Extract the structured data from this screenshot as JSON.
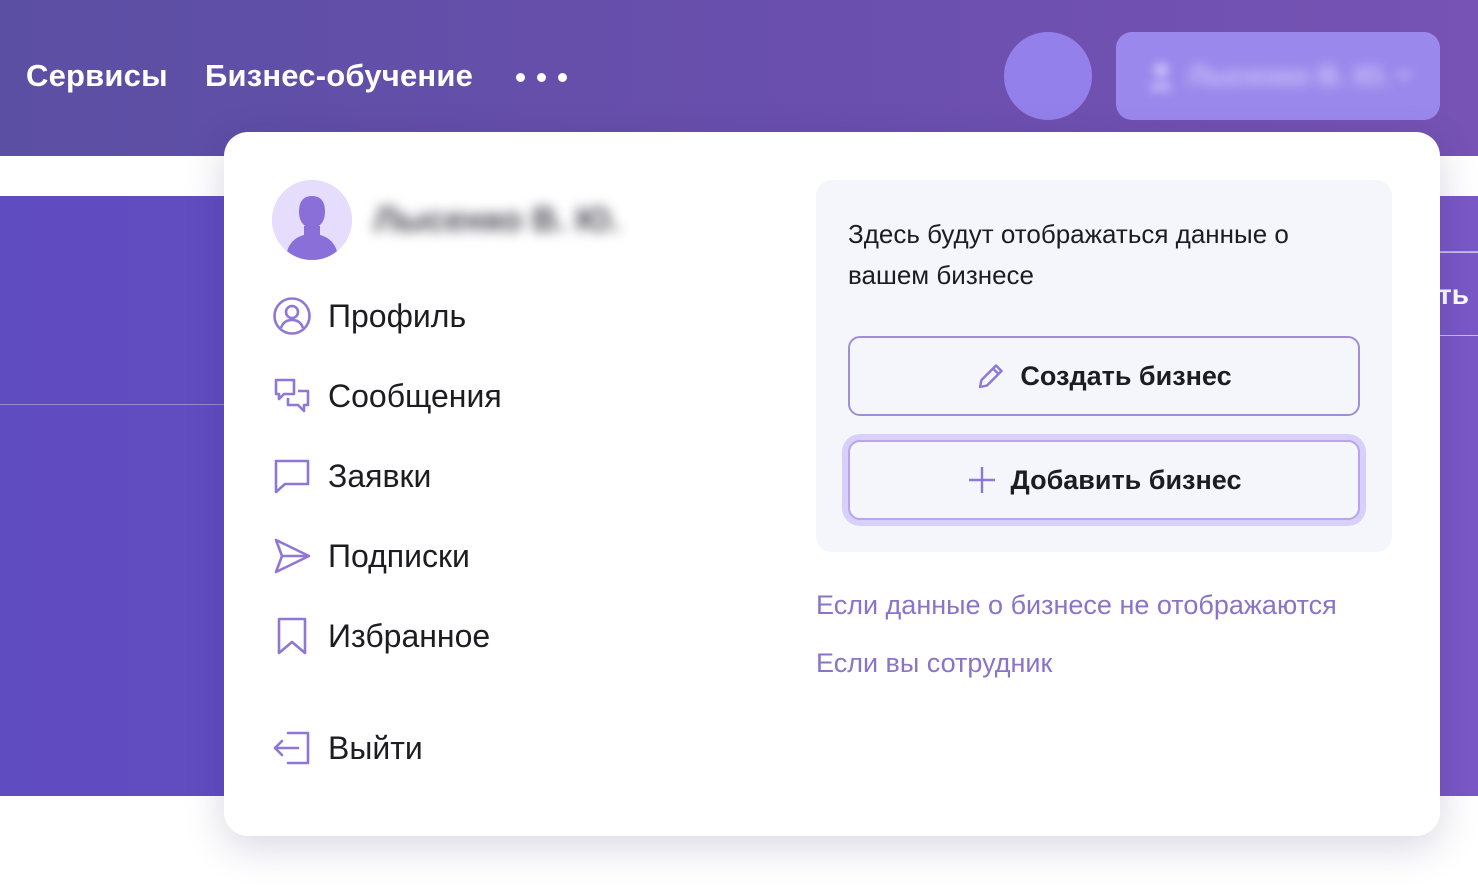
{
  "header": {
    "nav": [
      {
        "label": "Сервисы"
      },
      {
        "label": "Бизнес-обучение"
      }
    ],
    "more_icon": "more-dots-icon",
    "user_button": {
      "label": "Лысенко В. Ю.",
      "icon": "user-icon",
      "chevron": "chevron-down-icon"
    }
  },
  "background": {
    "right_button_fragment": "ть"
  },
  "dropdown": {
    "user_name": "Лысенко В. Ю.",
    "menu": [
      {
        "label": "Профиль",
        "icon": "profile-circle-icon"
      },
      {
        "label": "Сообщения",
        "icon": "messages-icon"
      },
      {
        "label": "Заявки",
        "icon": "chat-bubble-icon"
      },
      {
        "label": "Подписки",
        "icon": "send-icon"
      },
      {
        "label": "Избранное",
        "icon": "bookmark-icon"
      }
    ],
    "logout": {
      "label": "Выйти",
      "icon": "logout-icon"
    },
    "business": {
      "text": "Здесь будут отображаться данные о вашем бизнесе",
      "create_label": "Создать бизнес",
      "create_icon": "pencil-icon",
      "add_label": "Добавить бизнес",
      "add_icon": "plus-icon"
    },
    "links": [
      {
        "label": "Если данные о бизнесе не отображаются"
      },
      {
        "label": "Если вы сотрудник"
      }
    ]
  },
  "colors": {
    "accent": "#8a73c9",
    "icon": "#8f77d6",
    "header": "#5b4fa3"
  }
}
